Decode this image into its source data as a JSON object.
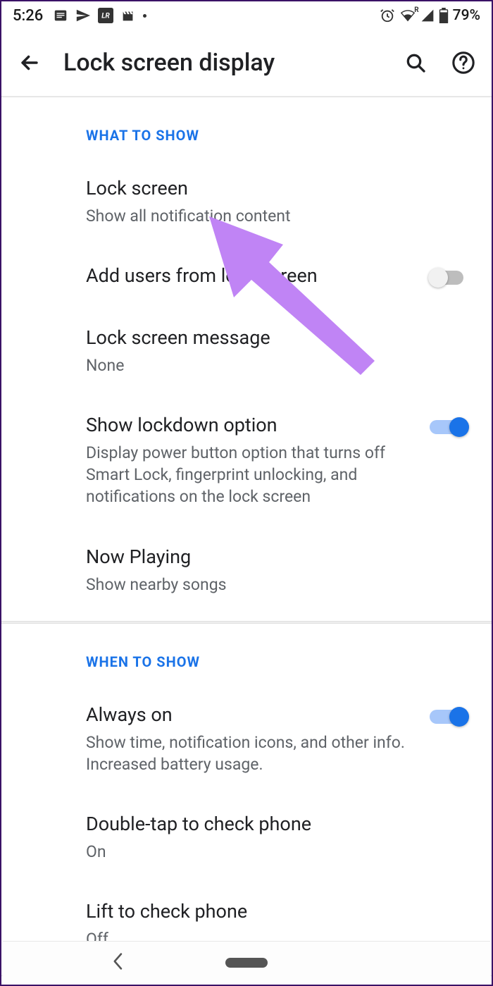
{
  "statusbar": {
    "time": "5:26",
    "battery": "79%",
    "roaming": "R"
  },
  "appbar": {
    "title": "Lock screen display"
  },
  "sections": [
    {
      "header": "WHAT TO SHOW",
      "items": [
        {
          "title": "Lock screen",
          "sub": "Show all notification content",
          "toggle": null
        },
        {
          "title": "Add users from lock screen",
          "sub": "",
          "toggle": false
        },
        {
          "title": "Lock screen message",
          "sub": "None",
          "toggle": null
        },
        {
          "title": "Show lockdown option",
          "sub": "Display power button option that turns off Smart Lock, fingerprint unlocking, and notifications on the lock screen",
          "toggle": true
        },
        {
          "title": "Now Playing",
          "sub": "Show nearby songs",
          "toggle": null
        }
      ]
    },
    {
      "header": "WHEN TO SHOW",
      "items": [
        {
          "title": "Always on",
          "sub": "Show time, notification icons, and other info. Increased battery usage.",
          "toggle": true
        },
        {
          "title": "Double-tap to check phone",
          "sub": "On",
          "toggle": null
        },
        {
          "title": "Lift to check phone",
          "sub": "Off",
          "toggle": null
        }
      ]
    }
  ]
}
